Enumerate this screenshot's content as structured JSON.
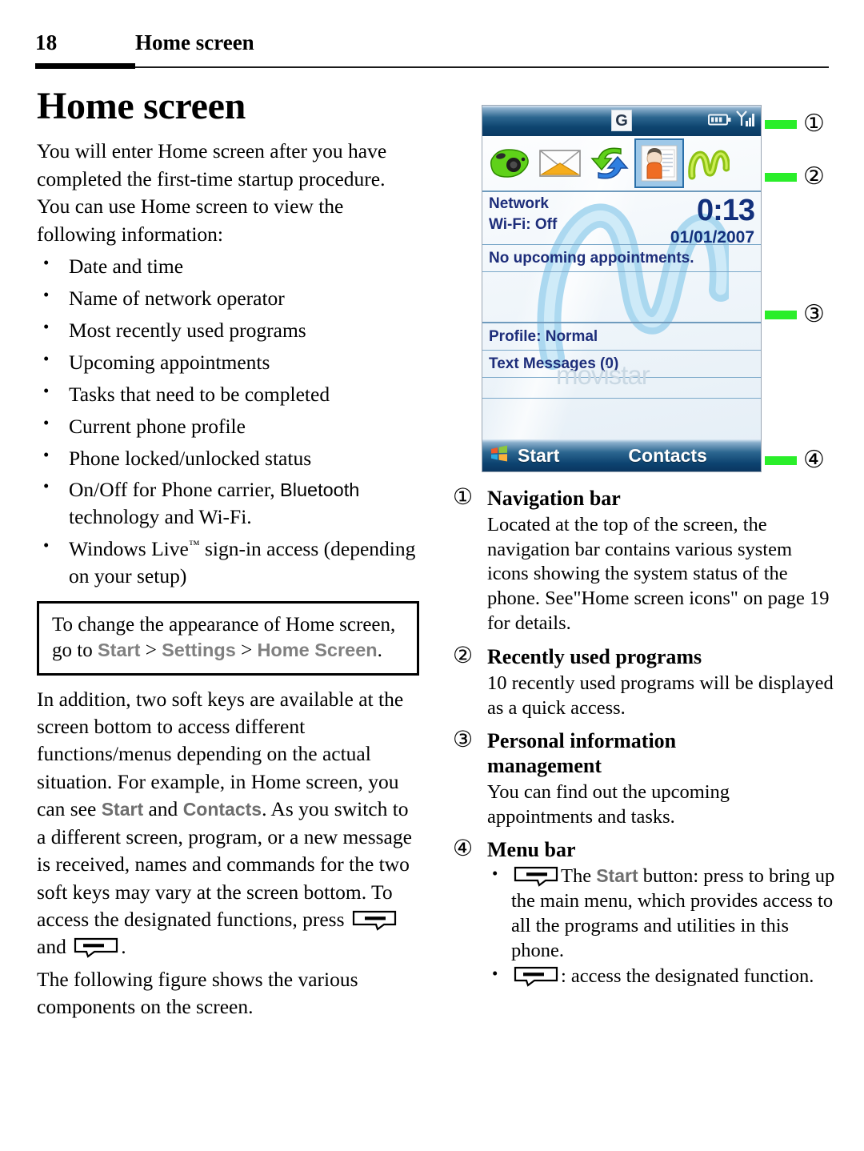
{
  "header": {
    "page_number": "18",
    "title": "Home screen"
  },
  "left": {
    "doc_title": "Home screen",
    "intro": "You will enter Home screen after you have completed the first-time startup procedure. You can use Home screen to view the following information:",
    "bullets": [
      "Date and time",
      "Name of network operator",
      "Most recently used programs",
      "Upcoming appointments",
      "Tasks that need to be completed",
      "Current phone profile",
      "Phone locked/unlocked status"
    ],
    "bullet_bluetooth_pre": "On/Off for Phone carrier, ",
    "bullet_bluetooth_word": "Bluetooth",
    "bullet_bluetooth_post": " technology and Wi-Fi.",
    "bullet_live_pre": "Windows Live",
    "bullet_live_tm": "™",
    "bullet_live_post": " sign-in access (depending on your setup)",
    "note": {
      "pre": "To change the appearance of Home screen, go to ",
      "start": "Start",
      "sep1": " > ",
      "settings": "Settings",
      "sep2": " > ",
      "home_screen": "Home Screen",
      "post": "."
    },
    "para2_a": "In addition, two soft keys are available at the screen bottom to access different functions/menus depending on the actual situation. For example, in Home screen, you can see ",
    "para2_start": "Start",
    "para2_b": " and ",
    "para2_contacts": "Contacts",
    "para2_c": ". As you switch to a different screen, program, or a new message is received, names and commands for the two soft keys may vary at the screen bottom. To access the designated functions, press",
    "para2_and": "and",
    "para2_period": ".",
    "para3": "The following figure shows the various components on the screen."
  },
  "phone": {
    "navbar": {
      "g_icon": "G",
      "battery_icon": "battery-icon",
      "signal_icon": "signal-icon"
    },
    "recent_programs": [
      "camera-icon",
      "messaging-icon",
      "activesync-icon",
      "contacts-icon",
      "movistar-icon"
    ],
    "network_label": "Network",
    "wifi_label": "Wi-Fi: Off",
    "time": "0:13",
    "date": "01/01/2007",
    "appointments": "No upcoming appointments.",
    "profile": "Profile: Normal",
    "text_messages": "Text Messages (0)",
    "watermark": "movistar",
    "menubar": {
      "start": "Start",
      "contacts": "Contacts",
      "windows_icon": "windows-logo-icon"
    }
  },
  "callouts": [
    {
      "num": "①"
    },
    {
      "num": "②"
    },
    {
      "num": "③"
    },
    {
      "num": "④"
    }
  ],
  "right": {
    "sections": [
      {
        "marker": "①",
        "title": "Navigation bar",
        "body": "Located at the top of the screen, the navigation bar contains various system icons showing the system status of the phone. See\"Home screen icons\" on page 19 for details."
      },
      {
        "marker": "②",
        "title": "Recently used programs",
        "body": "10 recently used programs will be displayed as a quick access."
      },
      {
        "marker": "③",
        "title": "Personal information management",
        "body": "You can find out the upcoming appointments and tasks."
      }
    ],
    "menu_bar": {
      "marker": "④",
      "title": "Menu bar",
      "bullet1_pre": "The ",
      "bullet1_start": "Start",
      "bullet1_post": " button: press to bring up the main menu, which provides access to all the programs and utilities in this phone.",
      "bullet2": ": access the designated function."
    }
  },
  "colors": {
    "callout_green": "#2aee2a",
    "ui_gray": "#808080",
    "phone_text_blue": "#1d2d7a",
    "navbar_blue": "#0e4570"
  }
}
